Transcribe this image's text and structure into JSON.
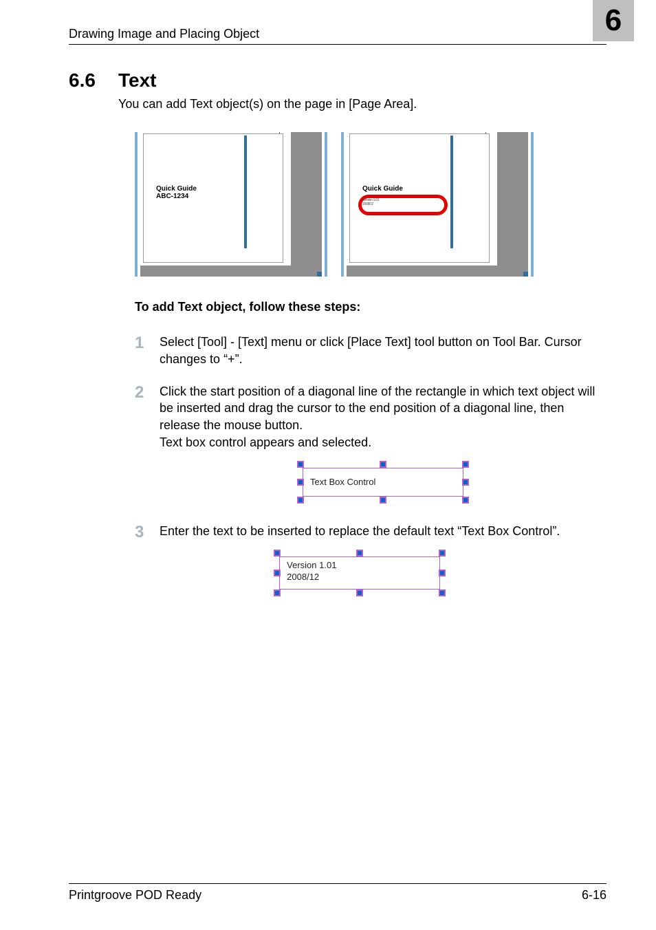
{
  "header": {
    "running": "Drawing Image and Placing Object",
    "chapter": "6"
  },
  "section": {
    "num": "6.6",
    "title": "Text",
    "intro": "You can add Text object(s) on the page in [Page Area]."
  },
  "thumbs": {
    "left_l1": "Quick Guide",
    "left_l2": "ABC-1234",
    "right_l1": "Quick Guide",
    "right_ver1": "Version 1.01",
    "right_ver2": "2008/12"
  },
  "sub_heading": "To add Text object, follow these steps:",
  "steps": {
    "s1": {
      "n": "1",
      "body": "Select [Tool] - [Text] menu or click [Place Text] tool button on Tool Bar. Cursor changes to “+”."
    },
    "s2": {
      "n": "2",
      "body_a": "Click the start position of a diagonal line of the rectangle in which text object will be inserted and drag the cursor to the end position of a di­agonal line, then release the mouse button.",
      "body_b": "Text box control appears and selected."
    },
    "s3": {
      "n": "3",
      "body": "Enter the text to be inserted to replace the default text “Text Box Con­trol”."
    }
  },
  "fig1_text": "Text Box Control",
  "fig2_line1": "Version 1.01",
  "fig2_line2": "2008/12",
  "footer": {
    "left": "Printgroove POD Ready",
    "right": "6-16"
  }
}
